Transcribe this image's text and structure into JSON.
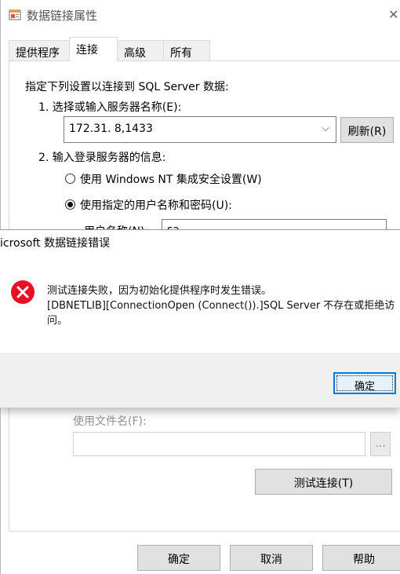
{
  "window": {
    "title": "数据链接属性"
  },
  "tabs": [
    "提供程序",
    "连接",
    "高级",
    "所有"
  ],
  "connection": {
    "intro": "指定下列设置以连接到 SQL Server 数据:",
    "step1": "1. 选择或输入服务器名称(E):",
    "server_value": "172.31.  8,1433",
    "refresh_button": "刷新(R)",
    "step2": "2. 输入登录服务器的信息:",
    "radio_windows": "使用 Windows NT 集成安全设置(W)",
    "radio_specific": "使用指定的用户名称和密码(U):",
    "username_label_partial": "用户名称(N):",
    "username_value_partial": "sa",
    "use_filename_label": "使用文件名(F):",
    "browse_button": "...",
    "test_button": "测试连接(T)"
  },
  "footer": {
    "ok": "确定",
    "cancel": "取消",
    "help": "帮助"
  },
  "error_dialog": {
    "title": "icrosoft 数据链接错误",
    "line1": "测试连接失败，因为初始化提供程序时发生错误。",
    "line2": "[DBNETLIB][ConnectionOpen (Connect()).]SQL Server 不存在或拒绝访",
    "line3": "问。",
    "ok": "确定"
  }
}
